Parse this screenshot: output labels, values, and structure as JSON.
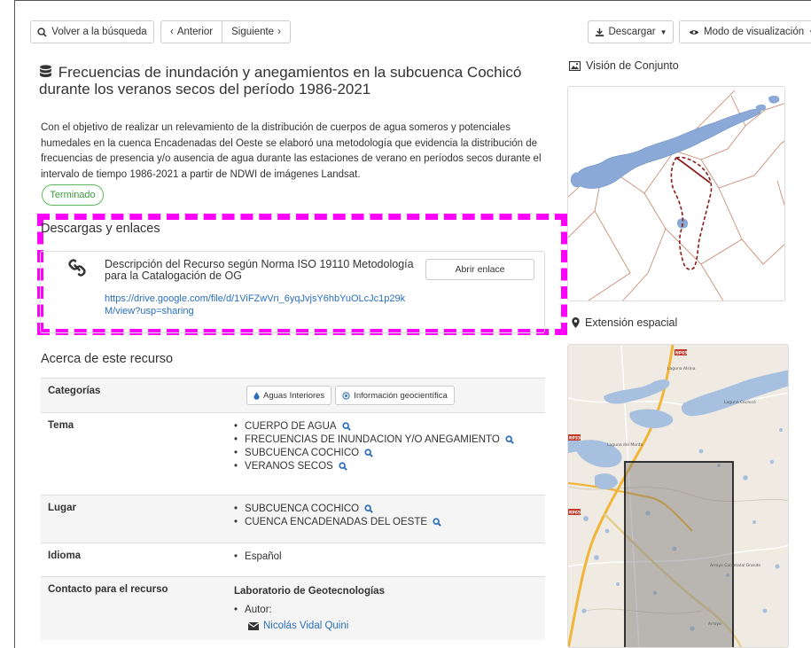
{
  "toolbar": {
    "back_label": "Volver a la búsqueda",
    "prev_label": "Anterior",
    "next_label": "Siguiente",
    "download_label": "Descargar",
    "view_mode_label": "Modo de visualización"
  },
  "record": {
    "title": "Frecuencias de inundación y anegamientos en la subcuenca Cochicó durante los veranos secos del período 1986-2021",
    "abstract": "Con el objetivo de realizar un relevamiento de la distribución de cuerpos de agua someros y potenciales humedales en la cuenca Encadenadas del Oeste se elaboró una metodología que evidencia la distribución de frecuencias de presencia y/o ausencia de agua durante las estaciones de verano en períodos secos durante el intervalo de tiempo 1986-2021 a partir de NDWI de imágenes Landsat.",
    "status": "Terminado",
    "status_color": "#5cb85c"
  },
  "downloads": {
    "heading": "Descargas y enlaces",
    "resource_title": "Descripción del Recurso según Norma ISO 19110 Metodología para la Catalogación de OG",
    "resource_url": "https://drive.google.com/file/d/1ViFZwVn_6yqJvjsY6hbYuOLcJc1p29kM/view?usp=sharing",
    "open_label": "Abrir enlace",
    "highlight_color": "#ff00ff"
  },
  "about": {
    "heading": "Acerca de este recurso",
    "categories_label": "Categorías",
    "categories": [
      "Aguas Interiores",
      "Información geocientífica"
    ],
    "theme_label": "Tema",
    "themes": [
      "CUERPO DE AGUA",
      "FRECUENCIAS DE INUNDACION Y/O ANEGAMIENTO",
      "SUBCUENCA COCHICO",
      "VERANOS SECOS"
    ],
    "place_label": "Lugar",
    "places": [
      "SUBCUENCA COCHICO",
      "CUENCA ENCADENADAS DEL OESTE"
    ],
    "language_label": "Idioma",
    "language": "Español",
    "contact_label": "Contacto para el recurso",
    "contact_org": "Laboratorio de Geotecnologías",
    "author_role": "Autor:",
    "author_name": "Nicolás Vidal Quini"
  },
  "sidebar": {
    "overview_heading": "Visión de Conjunto",
    "extent_heading": "Extensión espacial",
    "map_labels": {
      "lake1": "Laguna Alsina",
      "lake2": "Laguna Cochicó",
      "lake3": "Laguna del Monte",
      "stream": "Arroyo Curamalal Grande",
      "town": "Arroyo",
      "route_a": "NP65",
      "route_b": "RP33",
      "route_c": "RP65"
    }
  }
}
